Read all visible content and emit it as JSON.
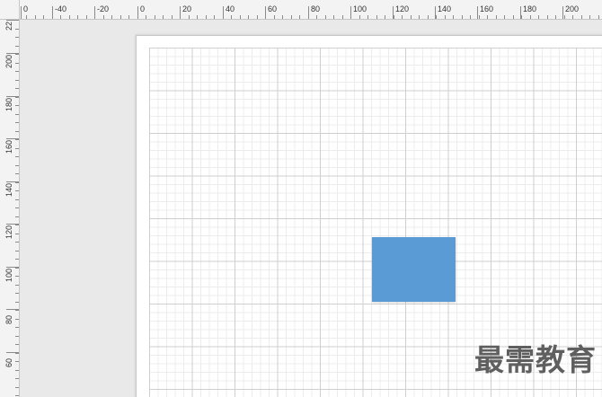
{
  "rulers": {
    "horizontal_labels": [
      "0",
      "-40",
      "-20",
      "0",
      "20",
      "40",
      "60",
      "80",
      "100",
      "120",
      "140",
      "160",
      "180",
      "200"
    ],
    "vertical_labels": [
      "22",
      "200",
      "180",
      "160",
      "140",
      "120",
      "100",
      "80",
      "60"
    ]
  },
  "shape": {
    "fill_color": "#5b9bd5"
  },
  "watermark": {
    "text": "最需教育"
  }
}
